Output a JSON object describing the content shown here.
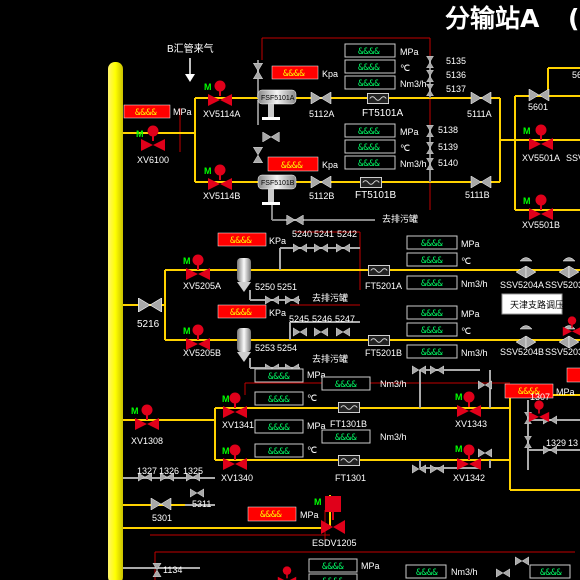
{
  "title": "分输站A",
  "title_suffix": "(",
  "placeholder": "&&&&",
  "source_label": "B汇管来气",
  "drain_label": "去排污罐",
  "button_label": "天津支路调压",
  "motor_label": "M",
  "units": {
    "mpa": "MPa",
    "kpa": "Kpa",
    "kpa2": "KPa",
    "degc": "℃",
    "flow": "Nm3/h"
  },
  "colors": {
    "pipe": "#ffd200",
    "header": "#ffff00",
    "valve": "#e0001a",
    "valve_gray": "#a0a0a0",
    "value_green": "#00ff66",
    "value_red_bg": "#ff0000",
    "button_bg": "#ffffff"
  },
  "labels": {
    "xv6100": "XV6100",
    "xv5114a": "XV5114A",
    "xv5114b": "XV5114B",
    "v5112a": "5112A",
    "v5112b": "5112B",
    "ft5101a": "FT5101A",
    "ft5101b": "FT5101B",
    "v5111a": "5111A",
    "v5111b": "5111B",
    "v5135": "5135",
    "v5136": "5136",
    "v5137": "5137",
    "v5138": "5138",
    "v5139": "5139",
    "v5140": "5140",
    "v5601": "5601",
    "xv5501a": "XV5501A",
    "xv5501b": "XV5501B",
    "ssv_a": "SSV",
    "v56": "56",
    "fsf_a": "FSF5101A",
    "fsf_b": "FSF5101B",
    "xv5205a": "XV5205A",
    "xv5205b": "XV5205B",
    "v5216": "5216",
    "v5240": "5240",
    "v5241": "5241",
    "v5242": "5242",
    "v5250": "5250",
    "v5251": "5251",
    "v5245": "5245",
    "v5246": "5246",
    "v5247": "5247",
    "v5253": "5253",
    "v5254": "5254",
    "ft5201a": "FT5201A",
    "ft5201b": "FT5201B",
    "ssv5204a": "SSV5204A",
    "ssv5203a": "SSV5203",
    "ssv5204b": "SSV5204B",
    "ssv5203b": "SSV5203",
    "xv1308": "XV1308",
    "xv1341": "XV1341",
    "xv1340": "XV1340",
    "ft1301b": "FT1301B",
    "ft1301": "FT1301",
    "xv1343": "XV1343",
    "xv1342": "XV1342",
    "v1307": "1307",
    "v1329": "1329",
    "v13x": "13",
    "v1327": "1327",
    "v1326": "1326",
    "v1325": "1325",
    "v5301": "5301",
    "v5311": "5311",
    "esdv1205": "ESDV1205",
    "v1134": "1134"
  }
}
